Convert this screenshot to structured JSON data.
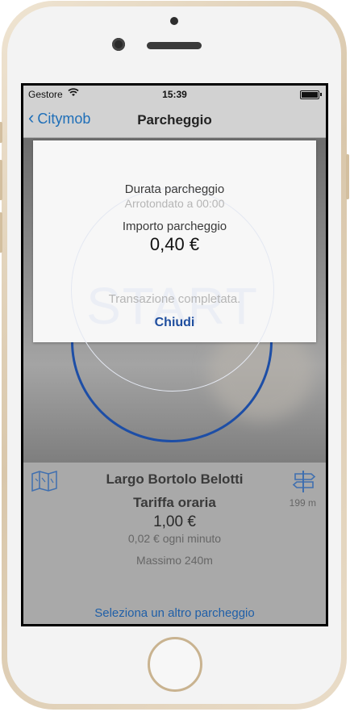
{
  "status_bar": {
    "carrier": "Gestore",
    "time": "15:39",
    "wifi_icon": "wifi-icon"
  },
  "nav": {
    "back_label": "Citymob",
    "title": "Parcheggio"
  },
  "background": {
    "start_label": "START",
    "accent_color": "#1d4ea6"
  },
  "modal": {
    "duration_label": "Durata parcheggio",
    "rounded_label": "Arrotondato a 00:00",
    "amount_label": "Importo parcheggio",
    "amount": "0,40 €",
    "status": "Transazione completata.",
    "close_label": "Chiudi"
  },
  "parking": {
    "street": "Largo Bortolo Belotti",
    "distance": "199 m",
    "tariff_label": "Tariffa oraria",
    "price": "1,00 €",
    "per_minute": "0,02 € ogni minuto",
    "max": "Massimo 240m",
    "other_link": "Seleziona un altro parcheggio"
  }
}
